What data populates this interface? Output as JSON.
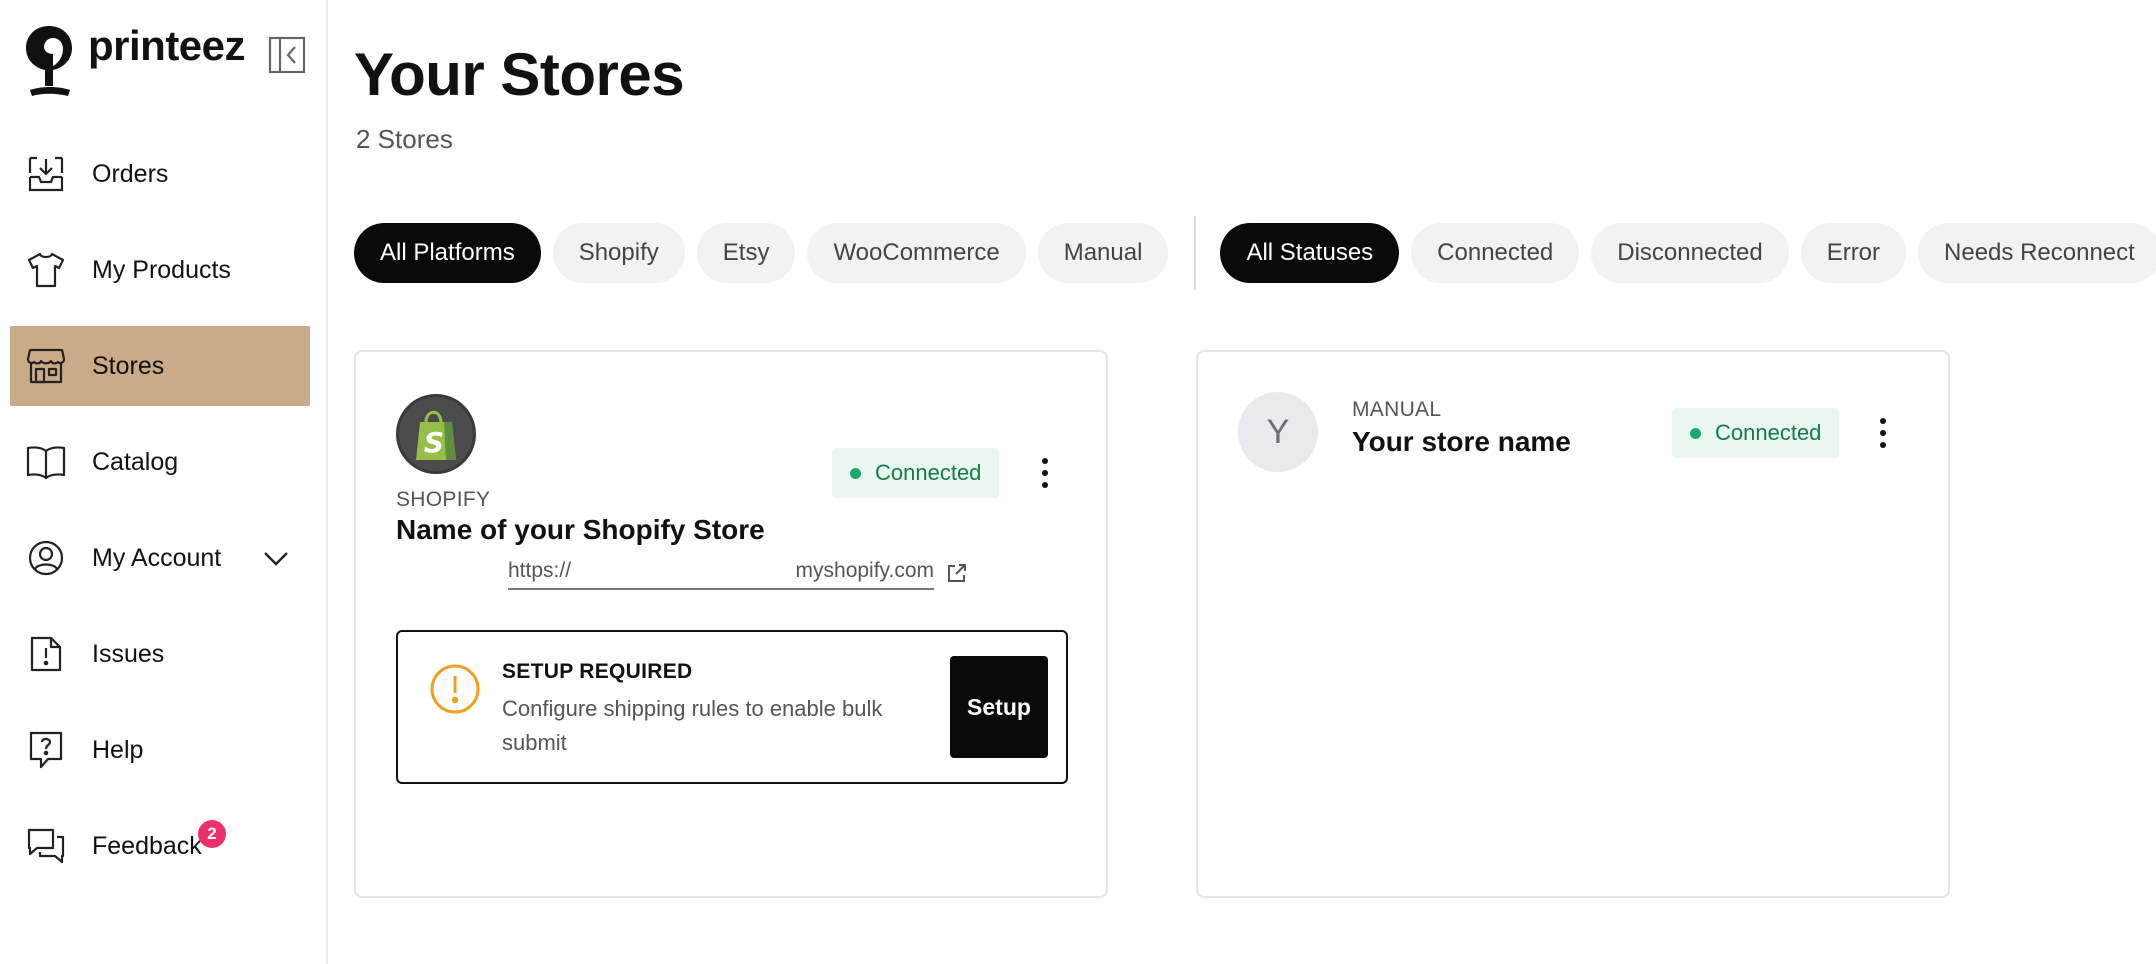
{
  "brand": {
    "name": "printeez"
  },
  "sidebar": {
    "items": [
      {
        "label": "Orders",
        "icon": "inbox-download-icon"
      },
      {
        "label": "My Products",
        "icon": "tshirt-icon"
      },
      {
        "label": "Stores",
        "icon": "storefront-icon",
        "active": true
      },
      {
        "label": "Catalog",
        "icon": "open-book-icon"
      },
      {
        "label": "My Account",
        "icon": "user-circle-icon"
      },
      {
        "label": "Issues",
        "icon": "file-alert-icon"
      },
      {
        "label": "Help",
        "icon": "help-chat-icon"
      },
      {
        "label": "Feedback",
        "icon": "chat-bubbles-icon",
        "badge": "2"
      }
    ]
  },
  "page": {
    "title": "Your Stores",
    "subtitle": "2 Stores"
  },
  "filters": {
    "platforms": [
      "All Platforms",
      "Shopify",
      "Etsy",
      "WooCommerce",
      "Manual"
    ],
    "statuses": [
      "All Statuses",
      "Connected",
      "Disconnected",
      "Error",
      "Needs Reconnect"
    ]
  },
  "stores": [
    {
      "platform": "SHOPIFY",
      "name": "Name of your Shopify Store",
      "url_prefix": "https://",
      "url_suffix": "myshopify.com",
      "status": "Connected",
      "setup": {
        "title": "SETUP REQUIRED",
        "description": "Configure shipping rules to enable bulk submit",
        "button": "Setup"
      }
    },
    {
      "avatar": "Y",
      "platform": "MANUAL",
      "name": "Your store name",
      "status": "Connected"
    }
  ],
  "colors": {
    "active_nav": "#c9ab88",
    "active_pill": "#0a0a0a",
    "status_bg": "#e8f8f0",
    "status_text": "#167a4c",
    "status_dot": "#1faa6b",
    "badge": "#ef2f69",
    "warning": "#f0a020",
    "shopify_green": "#95bf47"
  }
}
